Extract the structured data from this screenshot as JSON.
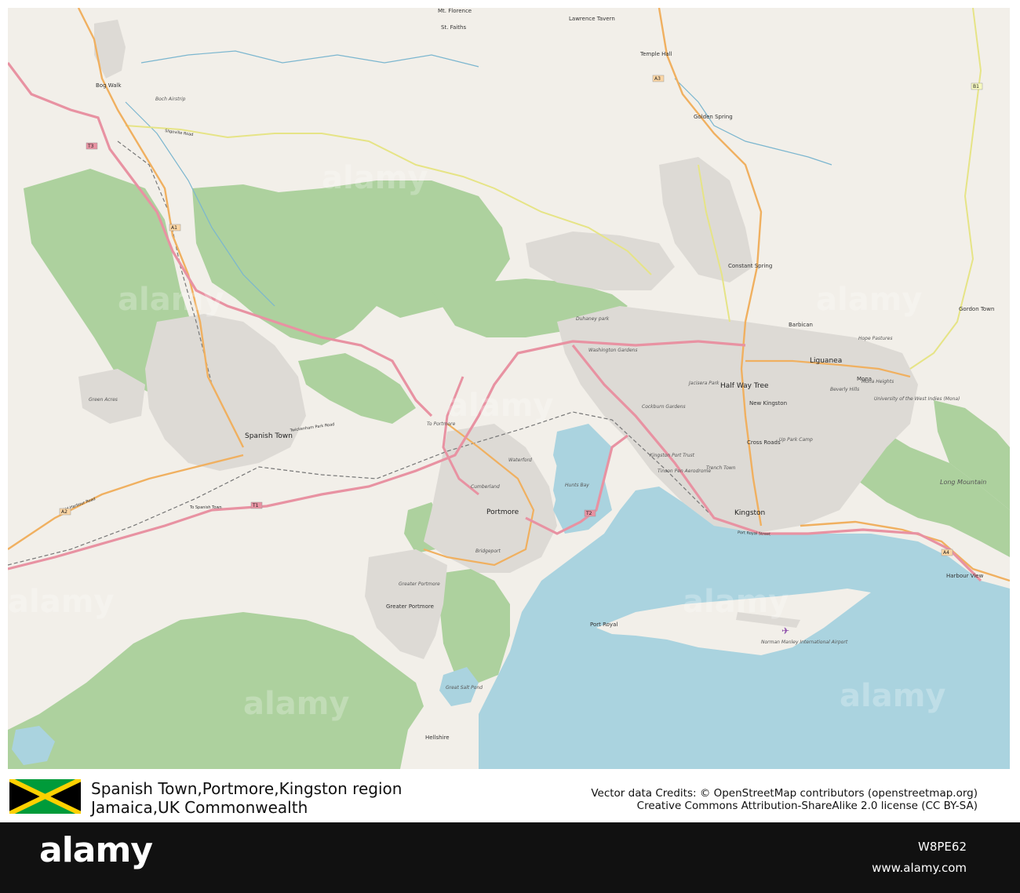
{
  "map": {
    "place_labels": {
      "mt_florence": "Mt. Florence",
      "lawrence_tavern": "Lawrence Tavern",
      "st_faiths": "St. Faiths",
      "temple_hall": "Temple Hall",
      "bog_walk": "Bog Walk",
      "golden_spring": "Golden Spring",
      "constant_spring": "Constant Spring",
      "gordon_town": "Gordon Town",
      "barbican": "Barbican",
      "liguanea": "Liguanea",
      "half_way_tree": "Half Way Tree",
      "new_kingston": "New Kingston",
      "mona": "Mona",
      "cross_roads": "Cross Roads",
      "spanish_town": "Spanish Town",
      "portmore": "Portmore",
      "kingston": "Kingston",
      "long_mountain": "Long Mountain",
      "harbour_view": "Harbour View",
      "greater_portmore": "Greater Portmore",
      "port_royal": "Port Royal",
      "hellshire": "Hellshire",
      "green_acres": "Green Acres",
      "to_portmore": "To Portmore"
    },
    "italic_labels": {
      "washington_gardens": "Washington Gardens",
      "duhaney_park": "Duhaney park",
      "cockburn_gardens": "Cockburn Gardens",
      "jacisera_park": "Jacisera Park",
      "trench_town": "Trench Town",
      "up_park_camp": "Up Park Camp",
      "cumberland": "Cumberland",
      "waterford": "Waterford",
      "bridgeport": "Bridgeport",
      "hunts_bay": "Hunts Bay",
      "beverly_hills": "Beverly Hills",
      "university": "University of the West Indies (Mona)",
      "mona_heights": "Mona Heights",
      "hope_pastures": "Hope Pastures",
      "kingston_port_trust": "Kingston Port Trust",
      "tinson_pen": "Tinson Pen Aerodrome",
      "airport": "Norman Manley International Airport",
      "greater_portmore_area": "Greater Portmore",
      "great_salt_pond": "Great Salt Pond",
      "boch_airstrip": "Boch Airstrip"
    },
    "road_labels": {
      "sligoville_road": "Sligoville Road",
      "old_harbour_road": "Old Harbour Road",
      "twickenham_park_road": "Twickenham Park Road",
      "port_royal_street": "Port Royal Street",
      "to_spanish_town": "To Spanish Town"
    },
    "shields": [
      "A1",
      "A2",
      "A3",
      "A4",
      "T1",
      "T2",
      "T3",
      "B1"
    ],
    "watermarks": [
      "alamy",
      "alamy",
      "alamy",
      "alamy",
      "alamy",
      "alamy",
      "alamy",
      "alamy"
    ]
  },
  "caption": {
    "title_line1": "Spanish Town,Portmore,Kingston region",
    "title_line2": "Jamaica,UK Commonwealth",
    "credit_line1": "Vector data Credits: © OpenStreetMap contributors (openstreetmap.org)",
    "credit_line2": "Creative Commons Attribution-ShareAlike 2.0 license (CC BY-SA)"
  },
  "stock": {
    "logo": "alamy",
    "image_id": "W8PE62",
    "url": "www.alamy.com"
  },
  "colors": {
    "land": "#f2efe9",
    "sea": "#aad3df",
    "forest": "#add19e",
    "urban": "#dddad5",
    "trunk": "#e892a2",
    "primary": "#fcd6a4",
    "secondary": "#f7fabf",
    "water_line": "#7bb6cf",
    "flag_green": "#009b3a",
    "flag_gold": "#fed100",
    "flag_black": "#000000"
  }
}
